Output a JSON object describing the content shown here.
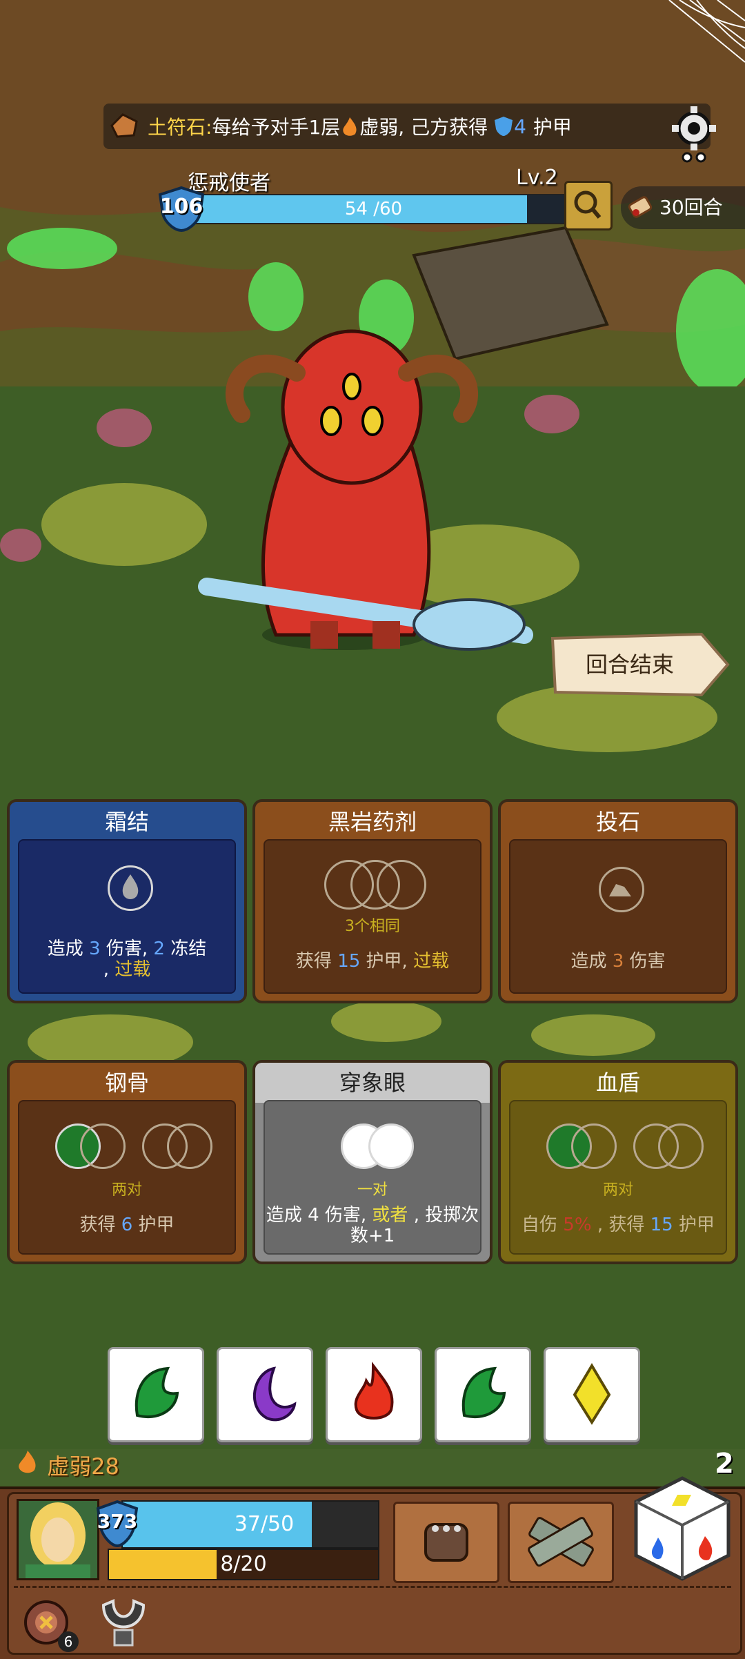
{
  "banner": {
    "rune_name": "土符石:",
    "text_before": "每给予对手1层",
    "weak": "虚弱",
    "text_mid": ", 己方获得",
    "armor_value": "4",
    "text_after": "护甲"
  },
  "enemy": {
    "name": "惩戒使者",
    "level": "Lv.2",
    "armor": "106",
    "hp_text": "54 /60",
    "hp_fraction": 0.9
  },
  "turns": {
    "label": "30回合"
  },
  "end_turn": {
    "label": "回合结束"
  },
  "cards": [
    {
      "title": "霜结",
      "desc_a": "造成",
      "dmg": "3",
      "desc_b": "伤害,",
      "freeze": "2",
      "desc_c": "冻结",
      "desc_d": ",",
      "overload": "过载"
    },
    {
      "title": "黑岩药剂",
      "req": "3个相同",
      "desc_a": "获得",
      "armor": "15",
      "desc_b": "护甲,",
      "overload": "过载"
    },
    {
      "title": "投石",
      "desc_a": "造成",
      "dmg": "3",
      "desc_b": "伤害"
    },
    {
      "title": "钢骨",
      "req": "两对",
      "desc_a": "获得",
      "armor": "6",
      "desc_b": "护甲"
    },
    {
      "title": "穿象眼",
      "req": "一对",
      "desc_a": "造成",
      "dmg": "4",
      "desc_b": "伤害,",
      "or": "或者",
      "desc_c": ", 投掷次数+1"
    },
    {
      "title": "血盾",
      "req": "两对",
      "desc_a": "自伤",
      "self_dmg": "5%",
      "desc_b": ", 获得",
      "armor": "15",
      "desc_c": "护甲"
    }
  ],
  "dice": [
    "leaf-green",
    "moon-purple",
    "fire-red",
    "leaf-green",
    "diamond-yellow"
  ],
  "player": {
    "weak_label": "虚弱28",
    "armor": "373",
    "hp_text": "37/50",
    "hp_fraction": 0.74,
    "energy_text": "8/20",
    "energy_fraction": 0.4,
    "rerolls": "2",
    "relic_count": "6"
  },
  "colors": {
    "hp": "#5fc6ee",
    "energy": "#f5c22e",
    "weak": "#f0a848",
    "overload": "#e5c030"
  }
}
